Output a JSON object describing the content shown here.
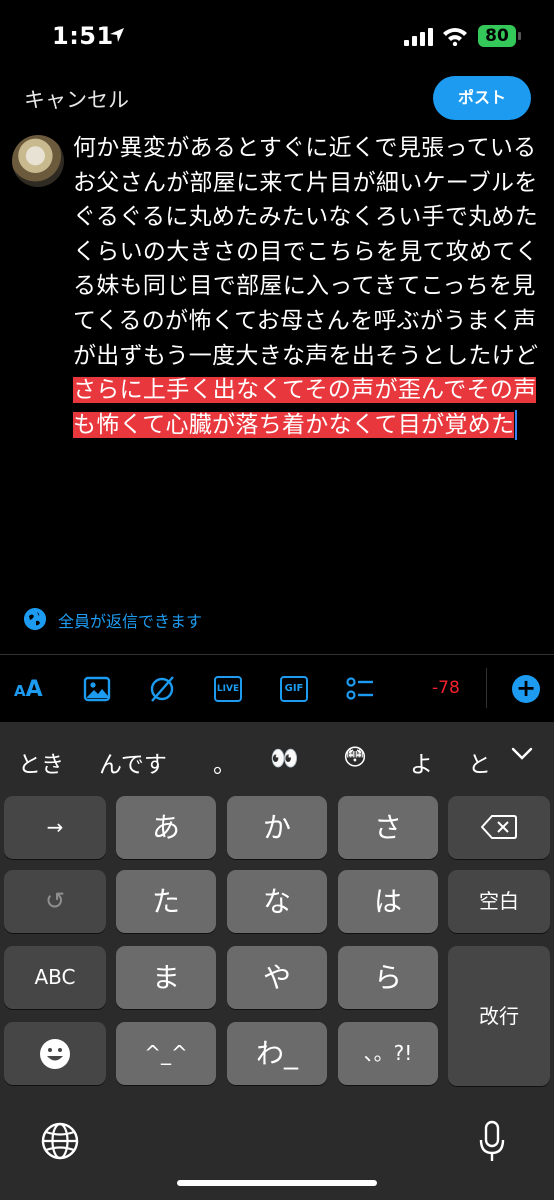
{
  "status_bar": {
    "time": "1:51",
    "battery": "80"
  },
  "header": {
    "cancel_label": "キャンセル",
    "post_label": "ポスト"
  },
  "compose": {
    "text_plain": "何か異変があるとすぐに近くで見張っているお父さんが部屋に来て片目が細いケーブルをぐるぐるに丸めたみたいなくろい手で丸めたくらいの大きさの目でこちらを見て攻めてくる妹も同じ目で部屋に入ってきてこっちを見てくるのが怖くてお母さんを呼ぶがうまく声が出ずもう一度大きな声を出そうとしたけど",
    "text_highlighted": "さらに上手く出なくてその声が歪んでその声も怖くて心臓が落ち着かなくて目が覚めた",
    "highlight_color": "#e8383d"
  },
  "reply_setting": {
    "label": "全員が返信できます"
  },
  "toolbar": {
    "text_size_label": "AA",
    "icons": [
      "image-icon",
      "no-gif-icon",
      "live-icon",
      "gif-icon",
      "poll-icon"
    ],
    "live_label": "LIVE",
    "gif_label": "GIF",
    "char_count": "-78",
    "accent_color": "#1d9bf0"
  },
  "keyboard": {
    "suggestions": [
      "とき",
      "んです",
      "。",
      "👀",
      "😳",
      "よ",
      "と"
    ],
    "keys": {
      "arrow": "→",
      "a": "あ",
      "ka": "か",
      "sa": "さ",
      "undo": "↺",
      "ta": "た",
      "na": "な",
      "ha": "は",
      "space": "空白",
      "abc": "ABC",
      "ma": "ま",
      "ya": "や",
      "ra": "ら",
      "enter": "改行",
      "caret": "^_^",
      "wa": "わ_",
      "punct": "、。?!"
    }
  }
}
